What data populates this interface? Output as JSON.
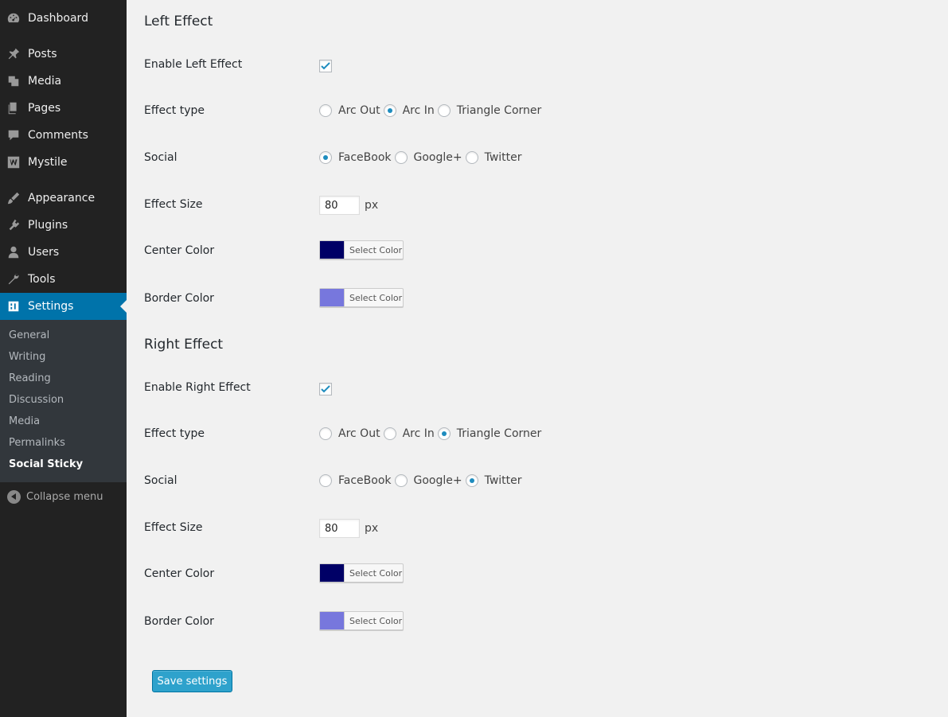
{
  "sidebar": {
    "items": [
      {
        "label": "Dashboard",
        "icon": "dashboard-icon"
      },
      {
        "label": "Posts",
        "icon": "pin-icon"
      },
      {
        "label": "Media",
        "icon": "media-icon"
      },
      {
        "label": "Pages",
        "icon": "pages-icon"
      },
      {
        "label": "Comments",
        "icon": "comment-icon"
      },
      {
        "label": "Mystile",
        "icon": "woo-icon"
      },
      {
        "label": "Appearance",
        "icon": "brush-icon"
      },
      {
        "label": "Plugins",
        "icon": "plug-icon"
      },
      {
        "label": "Users",
        "icon": "user-icon"
      },
      {
        "label": "Tools",
        "icon": "wrench-icon"
      },
      {
        "label": "Settings",
        "icon": "settings-icon",
        "active": true
      }
    ],
    "submenu": [
      {
        "label": "General"
      },
      {
        "label": "Writing"
      },
      {
        "label": "Reading"
      },
      {
        "label": "Discussion"
      },
      {
        "label": "Media"
      },
      {
        "label": "Permalinks"
      },
      {
        "label": "Social Sticky",
        "current": true
      }
    ],
    "collapse_label": "Collapse menu"
  },
  "left": {
    "title": "Left Effect",
    "enable_label": "Enable Left Effect",
    "enabled": true,
    "effect_type_label": "Effect type",
    "effect_options": [
      "Arc Out",
      "Arc In",
      "Triangle Corner"
    ],
    "effect_selected": "Arc In",
    "social_label": "Social",
    "social_options": [
      "FaceBook",
      "Google+",
      "Twitter"
    ],
    "social_selected": "FaceBook",
    "size_label": "Effect Size",
    "size_value": "80",
    "size_unit": "px",
    "center_label": "Center Color",
    "center_color": "#000066",
    "border_label": "Border Color",
    "border_color": "#7777dd",
    "select_color_label": "Select Color"
  },
  "right": {
    "title": "Right Effect",
    "enable_label": "Enable Right Effect",
    "enabled": true,
    "effect_type_label": "Effect type",
    "effect_options": [
      "Arc Out",
      "Arc In",
      "Triangle Corner"
    ],
    "effect_selected": "Triangle Corner",
    "social_label": "Social",
    "social_options": [
      "FaceBook",
      "Google+",
      "Twitter"
    ],
    "social_selected": "Twitter",
    "size_label": "Effect Size",
    "size_value": "80",
    "size_unit": "px",
    "center_label": "Center Color",
    "center_color": "#000066",
    "border_label": "Border Color",
    "border_color": "#7777dd",
    "select_color_label": "Select Color"
  },
  "save_label": "Save settings"
}
